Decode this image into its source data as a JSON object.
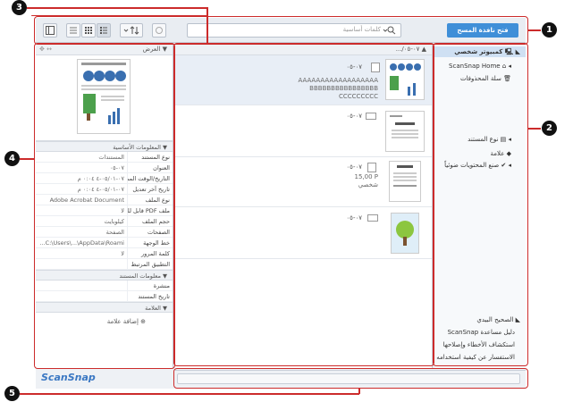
{
  "toolbar": {
    "search_placeholder": "كلمات أساسية",
    "scan_button": "فتح نافذة المسح"
  },
  "info_panel": {
    "header": "العرض",
    "basic_section": "المعلومات الأساسية",
    "rows": [
      {
        "key": "نوع المستند",
        "value": "المستندات"
      },
      {
        "key": "العنوان",
        "value": "٠٧-٠٥"
      },
      {
        "key": "التاريخ/الوقت المم...",
        "value": "٠٧-٠٥/٠١-٤ ٠:٠٤ م"
      },
      {
        "key": "تاريخ آخر تعديل",
        "value": "٠٧-٠٥/٠١-٤ ٠:٠٤ م"
      },
      {
        "key": "نوع الملف",
        "value": "Adobe Acrobat Document"
      },
      {
        "key": "ملف PDF قابل للـ...",
        "value": "لا"
      },
      {
        "key": "حجم الملف",
        "value": "كيلوبايت"
      },
      {
        "key": "الصفحات",
        "value": "الصفحة"
      },
      {
        "key": "خط الوجهة",
        "value": "C:\\Users\\...\\AppData\\Roami..."
      },
      {
        "key": "كلمة المرور",
        "value": "لا"
      },
      {
        "key": "التطبيق المرتبط",
        "value": ""
      }
    ],
    "doc_section": "معلومات المستند",
    "doc_rows": [
      {
        "key": "منشرة",
        "value": ""
      },
      {
        "key": "تاريخ المستند",
        "value": ""
      }
    ],
    "tag_section": "العلامة",
    "add_tag": "إضافة علامة"
  },
  "file_list": {
    "header_date": "٠٧-٠٥/...",
    "files": [
      {
        "date": "٠٧-٠٥",
        "line1": "AAAAAAAAAAAAAAAAAA",
        "line2": "BBBBBBBBBBBBBBBB",
        "line3": "CCCCCCCCC"
      },
      {
        "date": "٠٧-٠٥",
        "line1": "",
        "line2": "",
        "line3": ""
      },
      {
        "date": "٠٧-٠٥",
        "line1": "15,00 P",
        "line2": "شخصي",
        "line3": ""
      },
      {
        "date": "٠٧-٠٥",
        "line1": "",
        "line2": "",
        "line3": ""
      }
    ]
  },
  "nav": {
    "computer": "كمبيوتر شخصي",
    "home": "ScanSnap Home",
    "trash": "سلة المحذوفات",
    "doc_type": "نوع المستند",
    "tag": "علامة",
    "ocr": "صنع المحتويات ضوئياً",
    "help_header": "الصحيح البيدي",
    "help1": "دليل مساعدة ScanSnap",
    "help2": "استكشاف الأخطاء وإصلاحها",
    "help3": "الاستفسار عن كيفية استخدامه"
  },
  "footer": {
    "logo": "ScanSnap"
  },
  "callouts": [
    "1",
    "2",
    "3",
    "4",
    "5"
  ],
  "colors": {
    "accent": "#3f8fd8",
    "callout": "#cc2b2b"
  }
}
